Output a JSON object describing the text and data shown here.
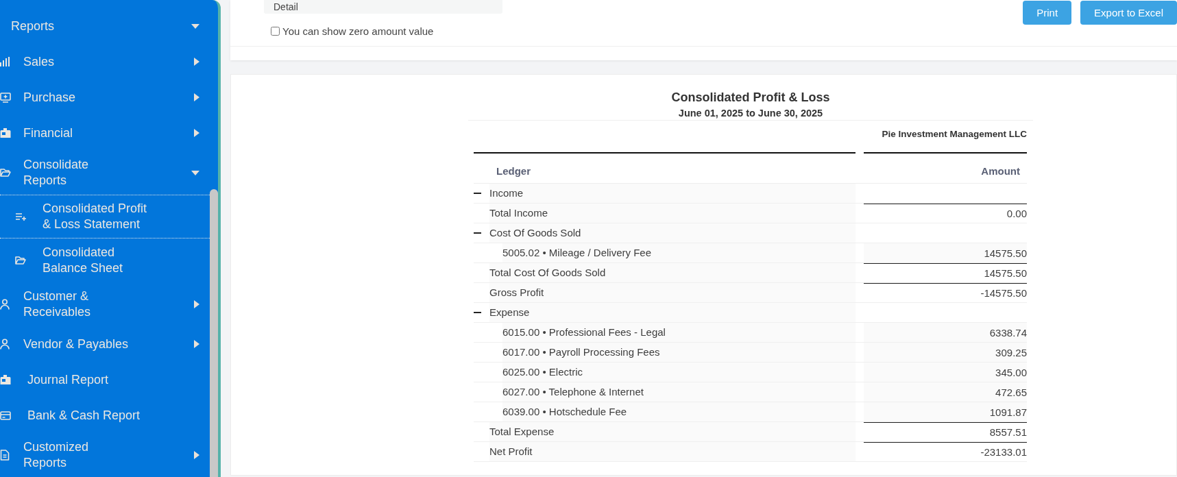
{
  "sidebar": {
    "header": {
      "label": "Reports",
      "expanded": true
    },
    "items": [
      {
        "label": "Sales",
        "kind": "submenu",
        "expanded": false
      },
      {
        "label": "Purchase",
        "kind": "submenu",
        "expanded": false
      },
      {
        "label": "Financial",
        "kind": "submenu",
        "expanded": false
      },
      {
        "label": "Consolidate Reports",
        "kind": "submenu",
        "expanded": true,
        "children": [
          {
            "label": "Consolidated Profit & Loss Statement",
            "selected": true
          },
          {
            "label": "Consolidated Balance Sheet",
            "selected": false
          }
        ]
      },
      {
        "label": "Customer & Receivables",
        "kind": "submenu",
        "expanded": false
      },
      {
        "label": "Vendor & Payables",
        "kind": "submenu",
        "expanded": false
      },
      {
        "label": "Journal Report",
        "kind": "link"
      },
      {
        "label": "Bank & Cash Report",
        "kind": "link"
      },
      {
        "label": "Customized Reports",
        "kind": "submenu",
        "expanded": false
      }
    ]
  },
  "toolbar": {
    "view_select": {
      "value": "Detail"
    },
    "zero_amount": {
      "label": "You can show zero amount value",
      "checked": false
    },
    "buttons": [
      "Print",
      "Export to Excel"
    ]
  },
  "report": {
    "title": "Consolidated Profit & Loss",
    "period": "June 01, 2025 to June 30, 2025",
    "company": "Pie Investment Management LLC",
    "columns": [
      "Ledger",
      "Amount"
    ],
    "rows": [
      {
        "kind": "group",
        "label": "Income",
        "expanded": true
      },
      {
        "kind": "total",
        "label": "Total Income",
        "amount": "0.00"
      },
      {
        "kind": "group",
        "label": "Cost Of Goods Sold",
        "expanded": true,
        "children": [
          {
            "label": "5005.02 • Mileage / Delivery Fee",
            "amount": "14575.50"
          }
        ]
      },
      {
        "kind": "total",
        "label": "Total Cost Of Goods Sold",
        "amount": "14575.50"
      },
      {
        "kind": "total",
        "label": "Gross Profit",
        "amount": "-14575.50"
      },
      {
        "kind": "group",
        "label": "Expense",
        "expanded": true,
        "children": [
          {
            "label": "6015.00 • Professional Fees - Legal",
            "amount": "6338.74"
          },
          {
            "label": "6017.00 • Payroll Processing Fees",
            "amount": "309.25"
          },
          {
            "label": "6025.00 • Electric",
            "amount": "345.00"
          },
          {
            "label": "6027.00 • Telephone & Internet",
            "amount": "472.65"
          },
          {
            "label": "6039.00 • Hotschedule Fee",
            "amount": "1091.87"
          }
        ]
      },
      {
        "kind": "total",
        "label": "Total Expense",
        "amount": "8557.51"
      },
      {
        "kind": "total",
        "label": "Net Profit",
        "amount": "-23133.01"
      }
    ]
  }
}
